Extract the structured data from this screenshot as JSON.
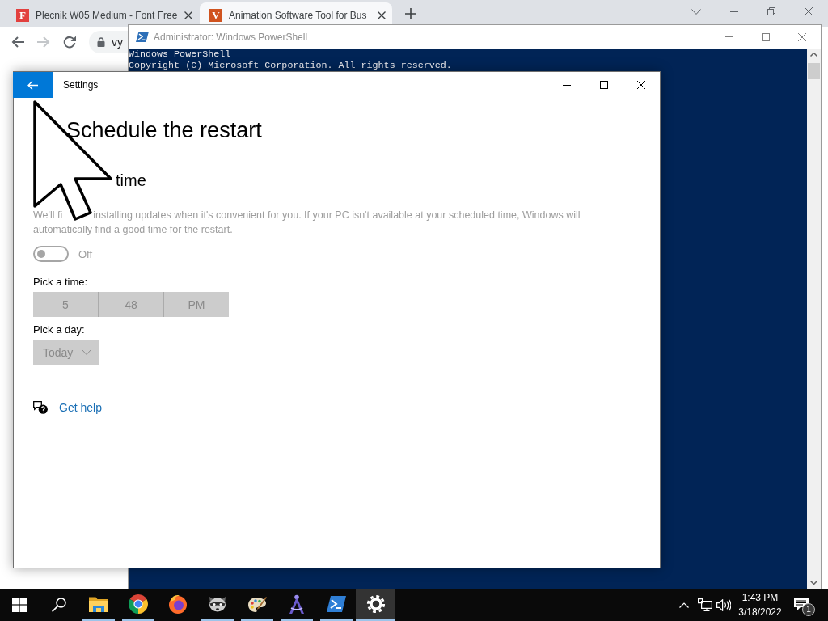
{
  "browser": {
    "tabs": [
      {
        "favicon_text": "F",
        "color": "#e2403e",
        "title": "Plecnik W05 Medium - Font Free",
        "selected": false
      },
      {
        "favicon_text": "V",
        "color": "#d0531f",
        "title": "Animation Software Tool for Bus",
        "selected": true
      }
    ],
    "forward_disabled": true,
    "address": "vy"
  },
  "terminal": {
    "title": "Administrator: Windows PowerShell",
    "lines": [
      "Windows PowerShell",
      "Copyright (C) Microsoft Corporation. All rights reserved."
    ]
  },
  "settings": {
    "title": "Settings",
    "page_title": "Schedule the restart",
    "section": {
      "title_visible": "time",
      "description_lines": [
        [
          "We'll fi",
          "installing updates when it's convenient for you. If your PC isn't available at your scheduled time, Windows will"
        ],
        [
          "automatically find a good time for the restart."
        ]
      ],
      "disabled": true,
      "toggle": {
        "label": "Off",
        "on": false
      },
      "time_picker": {
        "label": "Pick a time:",
        "fields": [
          "5",
          "48",
          "PM"
        ]
      },
      "day_picker": {
        "label": "Pick a day:",
        "value": "Today"
      }
    },
    "help_link": "Get help"
  },
  "taskbar": {
    "apps": [
      {
        "kind": "folder",
        "running": true,
        "selected": false
      },
      {
        "kind": "chrome",
        "running": true,
        "selected": false
      },
      {
        "kind": "firefox",
        "running": false,
        "selected": false
      },
      {
        "kind": "raccoon",
        "running": true,
        "selected": false
      },
      {
        "kind": "palette",
        "running": true,
        "selected": false
      },
      {
        "kind": "compass",
        "running": true,
        "selected": false
      },
      {
        "kind": "powershell",
        "running": true,
        "selected": false
      },
      {
        "kind": "settings",
        "running": true,
        "selected": true
      }
    ],
    "clock": {
      "time": "1:43 PM",
      "date": "3/18/2022"
    },
    "notification_count": "1"
  }
}
